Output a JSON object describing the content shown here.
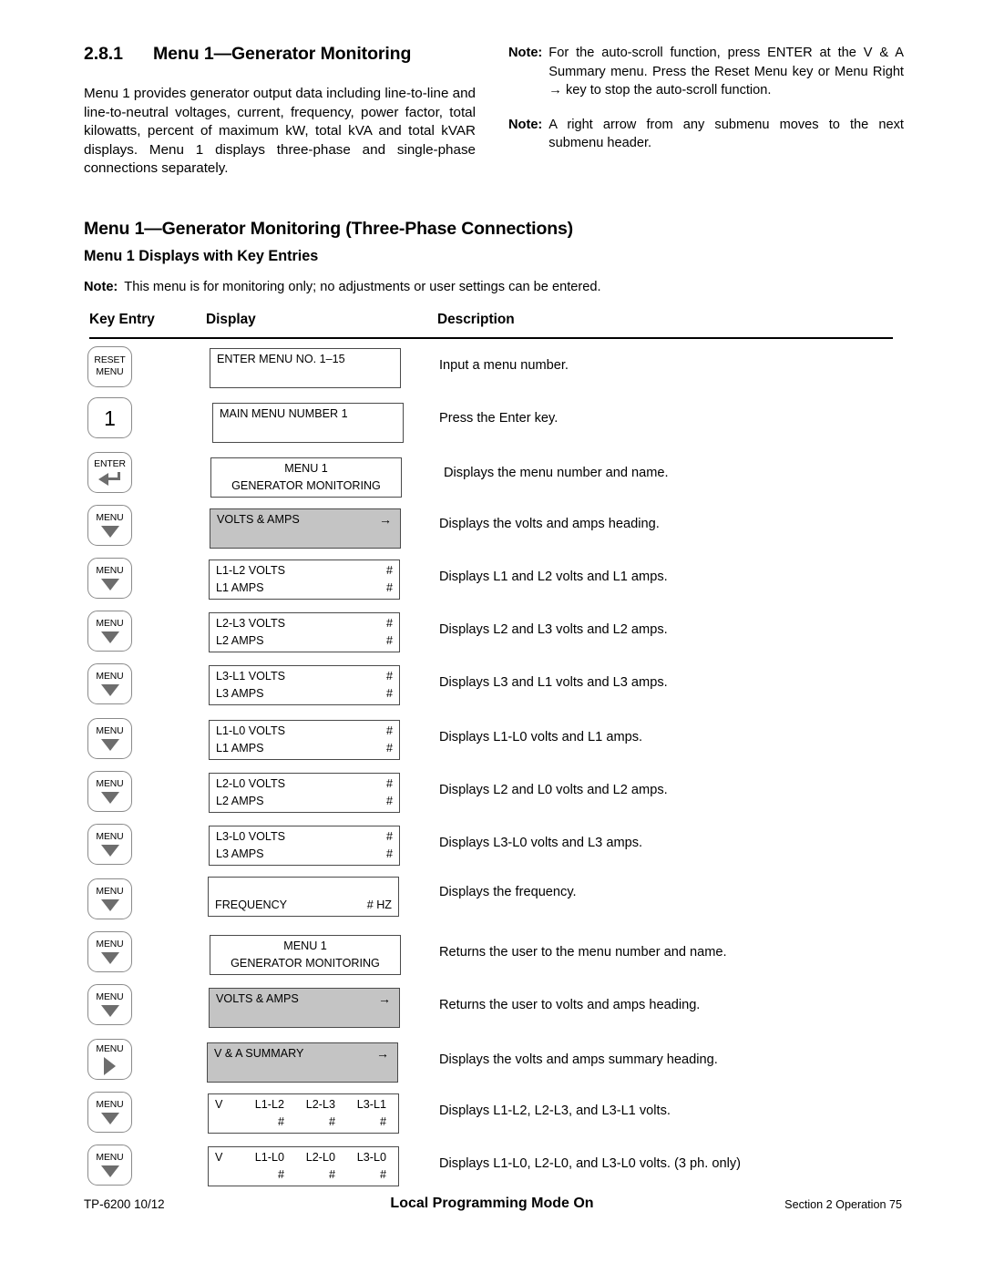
{
  "section": {
    "number": "2.8.1",
    "title": "Menu 1—Generator Monitoring",
    "paragraph": "Menu 1 provides generator output data including line-to-line and line-to-neutral voltages, current, frequency, power factor, total kilowatts, percent of maximum kW, total kVA and total kVAR displays. Menu 1 displays three-phase and single-phase connections separately."
  },
  "notes_top": [
    {
      "label": "Note:",
      "text": "For the auto-scroll function, press ENTER at the V & A Summary menu.  Press the Reset Menu key or Menu Right → key to stop the auto-scroll function."
    },
    {
      "label": "Note:",
      "text": "A right arrow from any submenu moves to the next submenu header."
    }
  ],
  "headings": {
    "major": "Menu 1—Generator Monitoring (Three-Phase Connections)",
    "minor": "Menu 1 Displays with Key Entries"
  },
  "note_table": {
    "label": "Note:",
    "text": "This menu is for monitoring only; no adjustments or user settings can be entered."
  },
  "table": {
    "columns": {
      "key_entry": "Key Entry",
      "display": "Display",
      "description": "Description"
    },
    "rows": [
      {
        "key": {
          "type": "two-line",
          "line1": "RESET",
          "line2": "MENU",
          "glyph": "none"
        },
        "display": {
          "style": "white",
          "layout": "two-line",
          "lines": [
            {
              "left": "ENTER MENU NO. 1–15",
              "right": ""
            },
            {
              "left": "",
              "right": ""
            }
          ]
        },
        "description": "Input a menu number."
      },
      {
        "key": {
          "type": "number",
          "line1": "1",
          "glyph": "none"
        },
        "display": {
          "style": "white",
          "layout": "two-line",
          "lines": [
            {
              "left": "MAIN MENU NUMBER 1",
              "right": ""
            },
            {
              "left": "",
              "right": ""
            }
          ]
        },
        "description": "Press the Enter key."
      },
      {
        "key": {
          "type": "one-line",
          "line1": "ENTER",
          "glyph": "enter-return"
        },
        "display": {
          "style": "white",
          "layout": "centered",
          "lines": [
            {
              "center": "MENU 1"
            },
            {
              "center": "GENERATOR MONITORING"
            }
          ]
        },
        "description": "Displays the menu number and name."
      },
      {
        "key": {
          "type": "one-line",
          "line1": "MENU",
          "glyph": "arrow-down"
        },
        "display": {
          "style": "gray",
          "layout": "two-line",
          "lines": [
            {
              "left": "VOLTS & AMPS",
              "right": "→"
            },
            {
              "left": "",
              "right": ""
            }
          ]
        },
        "description": "Displays the volts and amps heading."
      },
      {
        "key": {
          "type": "one-line",
          "line1": "MENU",
          "glyph": "arrow-down"
        },
        "display": {
          "style": "white",
          "layout": "two-line",
          "lines": [
            {
              "left": "L1-L2 VOLTS",
              "right": "#"
            },
            {
              "left": "L1 AMPS",
              "right": "#"
            }
          ]
        },
        "description": "Displays L1 and L2 volts and L1 amps."
      },
      {
        "key": {
          "type": "one-line",
          "line1": "MENU",
          "glyph": "arrow-down"
        },
        "display": {
          "style": "white",
          "layout": "two-line",
          "lines": [
            {
              "left": "L2-L3 VOLTS",
              "right": "#"
            },
            {
              "left": "L2 AMPS",
              "right": "#"
            }
          ]
        },
        "description": "Displays L2 and L3 volts and L2 amps."
      },
      {
        "key": {
          "type": "one-line",
          "line1": "MENU",
          "glyph": "arrow-down"
        },
        "display": {
          "style": "white",
          "layout": "two-line",
          "lines": [
            {
              "left": "L3-L1 VOLTS",
              "right": "#"
            },
            {
              "left": "L3 AMPS",
              "right": "#"
            }
          ]
        },
        "description": "Displays L3 and L1 volts and L3 amps."
      },
      {
        "key": {
          "type": "one-line",
          "line1": "MENU",
          "glyph": "arrow-down"
        },
        "display": {
          "style": "white",
          "layout": "two-line",
          "lines": [
            {
              "left": "L1-L0 VOLTS",
              "right": "#"
            },
            {
              "left": "L1 AMPS",
              "right": "#"
            }
          ]
        },
        "description": "Displays L1-L0 volts and L1 amps."
      },
      {
        "key": {
          "type": "one-line",
          "line1": "MENU",
          "glyph": "arrow-down"
        },
        "display": {
          "style": "white",
          "layout": "two-line",
          "lines": [
            {
              "left": "L2-L0 VOLTS",
              "right": "#"
            },
            {
              "left": "L2 AMPS",
              "right": "#"
            }
          ]
        },
        "description": "Displays L2 and L0 volts and L2 amps."
      },
      {
        "key": {
          "type": "one-line",
          "line1": "MENU",
          "glyph": "arrow-down"
        },
        "display": {
          "style": "white",
          "layout": "two-line",
          "lines": [
            {
              "left": "L3-L0 VOLTS",
              "right": "#"
            },
            {
              "left": "L3 AMPS",
              "right": "#"
            }
          ]
        },
        "description": "Displays L3-L0 volts and L3 amps."
      },
      {
        "key": {
          "type": "one-line",
          "line1": "MENU",
          "glyph": "arrow-down"
        },
        "display": {
          "style": "white",
          "layout": "two-line",
          "lines": [
            {
              "left": "",
              "right": ""
            },
            {
              "left": "FREQUENCY",
              "right": "# HZ"
            }
          ]
        },
        "description": "Displays the frequency."
      },
      {
        "key": {
          "type": "one-line",
          "line1": "MENU",
          "glyph": "arrow-down"
        },
        "display": {
          "style": "white",
          "layout": "centered",
          "lines": [
            {
              "center": "MENU 1"
            },
            {
              "center": "GENERATOR MONITORING"
            }
          ]
        },
        "description": "Returns the user to the menu number and name."
      },
      {
        "key": {
          "type": "one-line",
          "line1": "MENU",
          "glyph": "arrow-down"
        },
        "display": {
          "style": "gray",
          "layout": "two-line",
          "lines": [
            {
              "left": "VOLTS & AMPS",
              "right": "→"
            },
            {
              "left": "",
              "right": ""
            }
          ]
        },
        "description": "Returns the user to volts and amps heading."
      },
      {
        "key": {
          "type": "one-line",
          "line1": "MENU",
          "glyph": "arrow-right"
        },
        "display": {
          "style": "gray",
          "layout": "two-line",
          "lines": [
            {
              "left": "V & A SUMMARY",
              "right": "→"
            },
            {
              "left": "",
              "right": ""
            }
          ]
        },
        "description": "Displays the volts and amps summary heading."
      },
      {
        "key": {
          "type": "one-line",
          "line1": "MENU",
          "glyph": "arrow-down"
        },
        "display": {
          "style": "white",
          "layout": "summary",
          "lines": [
            {
              "c0": "V",
              "c1": "L1-L2",
              "c2": "L2-L3",
              "c3": "L3-L1"
            },
            {
              "c0": "",
              "c1": "#",
              "c2": "#",
              "c3": "#"
            }
          ]
        },
        "description": "Displays L1-L2, L2-L3, and L3-L1 volts."
      },
      {
        "key": {
          "type": "one-line",
          "line1": "MENU",
          "glyph": "arrow-down"
        },
        "display": {
          "style": "white",
          "layout": "summary",
          "lines": [
            {
              "c0": "V",
              "c1": "L1-L0",
              "c2": "L2-L0",
              "c3": "L3-L0"
            },
            {
              "c0": "",
              "c1": "#",
              "c2": "#",
              "c3": "#"
            }
          ]
        },
        "description": "Displays L1-L0, L2-L0, and L3-L0 volts.  (3 ph. only)"
      }
    ]
  },
  "footer": {
    "left": "TP-6200  10/12",
    "center": "Local Programming Mode On",
    "right": "Section 2  Operation   75"
  },
  "colors": {
    "lcd_gray": "#c4c4c4",
    "key_border": "#8a8a8a",
    "glyph_gray": "#6d6d6d",
    "text": "#000000"
  }
}
